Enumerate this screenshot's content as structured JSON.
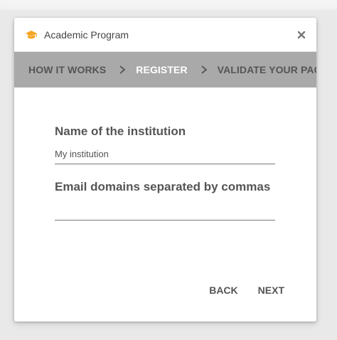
{
  "dialog": {
    "title": "Academic Program",
    "icon": "graduation-cap-icon",
    "icon_color": "#f5a623",
    "close_icon": "close-icon"
  },
  "steps": [
    {
      "label": "HOW IT WORKS",
      "active": false
    },
    {
      "label": "REGISTER",
      "active": true
    },
    {
      "label": "VALIDATE YOUR PAGE",
      "active": false
    }
  ],
  "form": {
    "institution": {
      "label": "Name of the institution",
      "value": "My institution"
    },
    "domains": {
      "label": "Email domains separated by commas",
      "value": ""
    }
  },
  "actions": {
    "back": "BACK",
    "next": "NEXT"
  },
  "colors": {
    "step_bar": "#a9a9a9",
    "active_step": "#ffffff",
    "text": "#555555"
  }
}
